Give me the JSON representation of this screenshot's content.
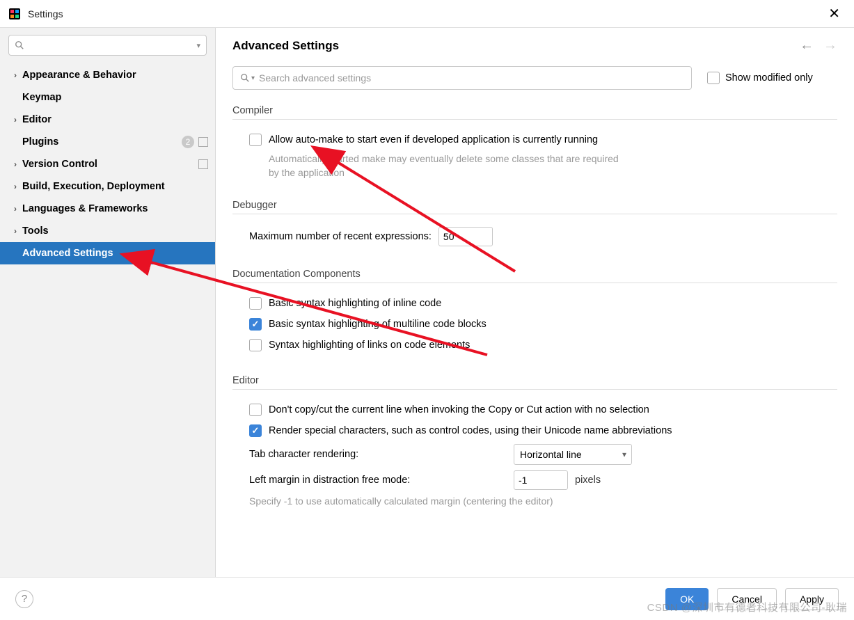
{
  "window": {
    "title": "Settings"
  },
  "sidebar": {
    "search_value": "",
    "items": [
      {
        "label": "Appearance & Behavior",
        "expandable": true
      },
      {
        "label": "Keymap",
        "expandable": false
      },
      {
        "label": "Editor",
        "expandable": true
      },
      {
        "label": "Plugins",
        "expandable": false,
        "badge": "2",
        "proj_icon": true
      },
      {
        "label": "Version Control",
        "expandable": true,
        "proj_icon": true
      },
      {
        "label": "Build, Execution, Deployment",
        "expandable": true
      },
      {
        "label": "Languages & Frameworks",
        "expandable": true
      },
      {
        "label": "Tools",
        "expandable": true
      },
      {
        "label": "Advanced Settings",
        "expandable": false,
        "selected": true
      }
    ]
  },
  "page": {
    "title": "Advanced Settings",
    "search_placeholder": "Search advanced settings",
    "show_modified_only_label": "Show modified only",
    "show_modified_only_checked": false
  },
  "sections": {
    "compiler": {
      "title": "Compiler",
      "allow_auto_make": {
        "label": "Allow auto-make to start even if developed application is currently running",
        "checked": false,
        "hint": "Automatically started make may eventually delete some classes that are required by the application"
      }
    },
    "debugger": {
      "title": "Debugger",
      "max_recent_label": "Maximum number of recent expressions:",
      "max_recent_value": "50"
    },
    "doc": {
      "title": "Documentation Components",
      "inline": {
        "label": "Basic syntax highlighting of inline code",
        "checked": false
      },
      "multiline": {
        "label": "Basic syntax highlighting of multiline code blocks",
        "checked": true
      },
      "links": {
        "label": "Syntax highlighting of links on code elements",
        "checked": false
      }
    },
    "editor": {
      "title": "Editor",
      "dont_copy": {
        "label": "Don't copy/cut the current line when invoking the Copy or Cut action with no selection",
        "checked": false
      },
      "render_special": {
        "label": "Render special characters, such as control codes, using their Unicode name abbreviations",
        "checked": true
      },
      "tab_rendering_label": "Tab character rendering:",
      "tab_rendering_value": "Horizontal line",
      "left_margin_label": "Left margin in distraction free mode:",
      "left_margin_value": "-1",
      "left_margin_unit": "pixels",
      "left_margin_hint": "Specify -1 to use automatically calculated margin (centering the editor)"
    }
  },
  "footer": {
    "ok": "OK",
    "cancel": "Cancel",
    "apply": "Apply"
  },
  "watermark": "CSDN @深圳市有德者科技有限公司-耿瑞"
}
